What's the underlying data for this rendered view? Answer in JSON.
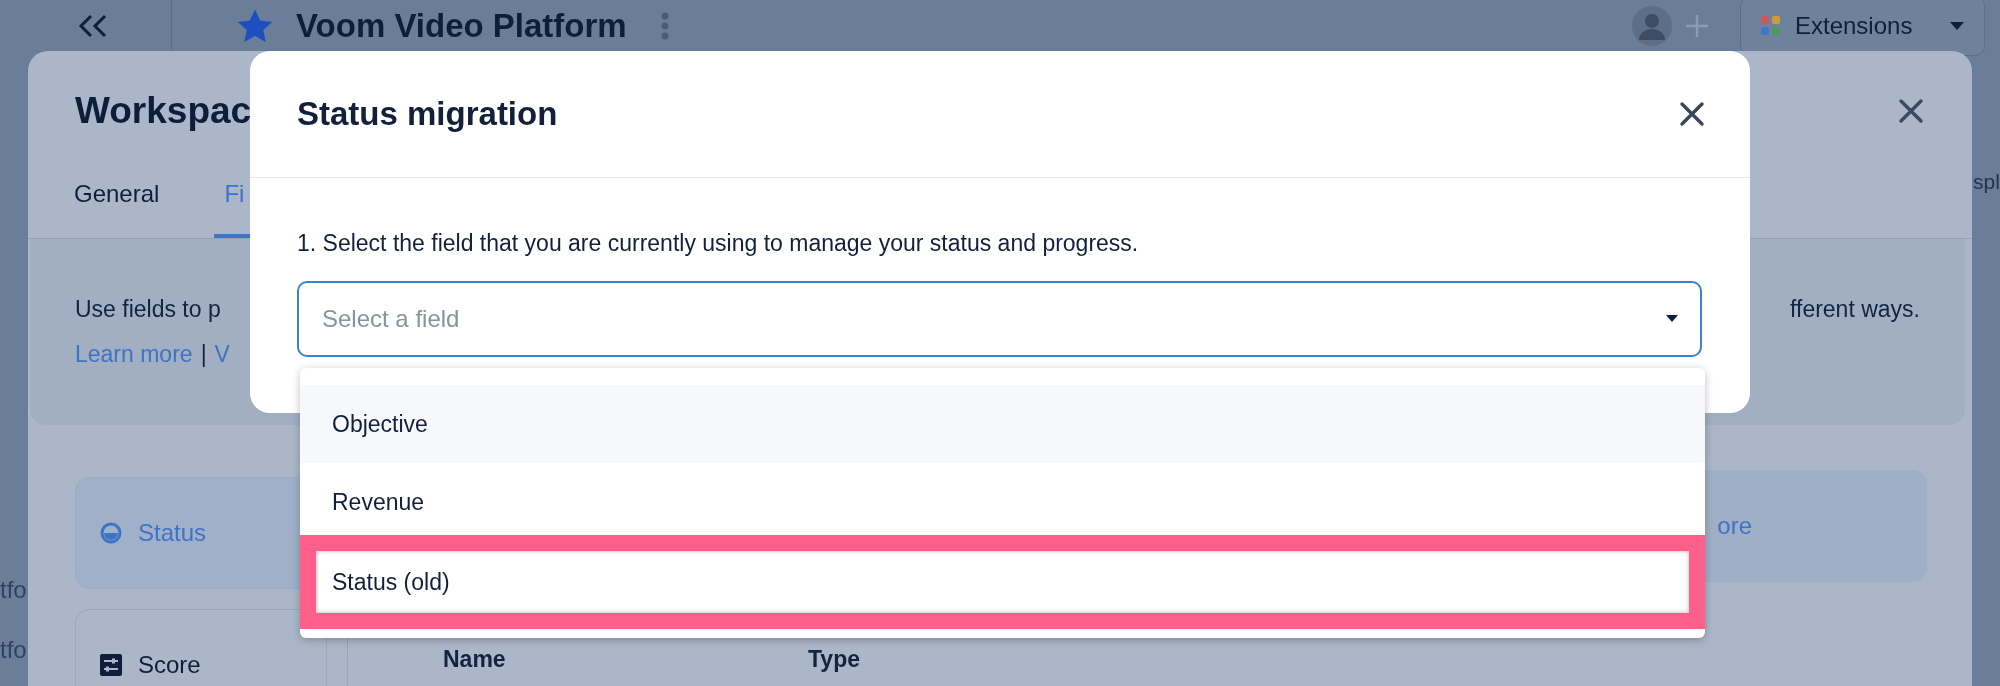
{
  "app_bar": {
    "title": "Voom Video Platform",
    "extensions_button": "Extensions"
  },
  "background_fragments": [
    {
      "text": "spl",
      "kind": "right"
    },
    {
      "text": "tfo",
      "kind": "left"
    },
    {
      "text": "tfo",
      "kind": "left"
    }
  ],
  "workspace_panel": {
    "title": "Workspac",
    "tabs": [
      {
        "label": "General",
        "selected": false
      },
      {
        "label": "Fi",
        "selected": true
      }
    ],
    "description_start": "Use fields to p",
    "description_end": "fferent ways.",
    "links": [
      "Learn more",
      "V"
    ],
    "link_separator": "|",
    "field_types": [
      {
        "label": "Status",
        "selected": true,
        "kind": "status"
      },
      {
        "label": "Score",
        "selected": false,
        "kind": "score"
      }
    ],
    "banner_link": "ore",
    "columns": [
      "Name",
      "Type"
    ]
  },
  "modal": {
    "title": "Status migration",
    "step_label": "1. Select the field that you are currently using to manage your status and progress.",
    "select": {
      "placeholder": "Select a field",
      "expanded": true
    },
    "options": [
      {
        "label": "Objective",
        "hovered": true,
        "highlighted": false
      },
      {
        "label": "Revenue",
        "hovered": false,
        "highlighted": false
      },
      {
        "label": "Status (old)",
        "hovered": false,
        "highlighted": true
      }
    ]
  }
}
